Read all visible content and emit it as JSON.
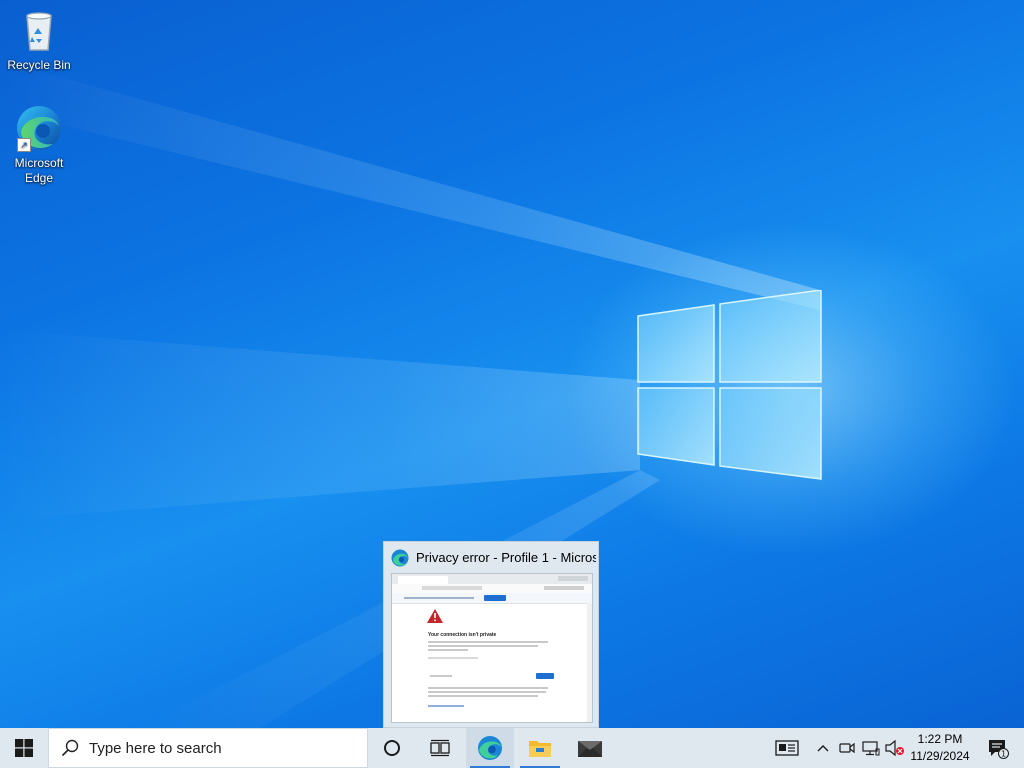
{
  "desktop": {
    "icons": [
      {
        "label": "Recycle Bin",
        "icon": "recycle-bin-icon"
      },
      {
        "label": "Microsoft Edge",
        "icon": "edge-icon"
      }
    ]
  },
  "preview": {
    "title": "Privacy error - Profile 1 - Micros...",
    "page_heading": "Your connection isn't private",
    "icon": "edge-icon"
  },
  "taskbar": {
    "start_icon": "windows-start-icon",
    "search_placeholder": "Type here to search",
    "apps": [
      {
        "name": "cortana",
        "icon": "cortana-circle-icon"
      },
      {
        "name": "task-view",
        "icon": "task-view-icon"
      },
      {
        "name": "edge",
        "icon": "edge-icon",
        "active": true
      },
      {
        "name": "file-explorer",
        "icon": "folder-icon"
      },
      {
        "name": "mail",
        "icon": "mail-icon"
      }
    ],
    "tray": {
      "news_icon": "news-icon",
      "chevron_icon": "chevron-up-icon",
      "meet_icon": "meet-now-icon",
      "network_icon": "network-icon",
      "volume_icon": "volume-muted-icon",
      "time": "1:22 PM",
      "date": "11/29/2024",
      "notification_count": "1"
    }
  },
  "colors": {
    "accent": "#2f7bd6",
    "taskbar_bg": "#dfe8ef",
    "desktop_blue": "#0c74e2"
  }
}
